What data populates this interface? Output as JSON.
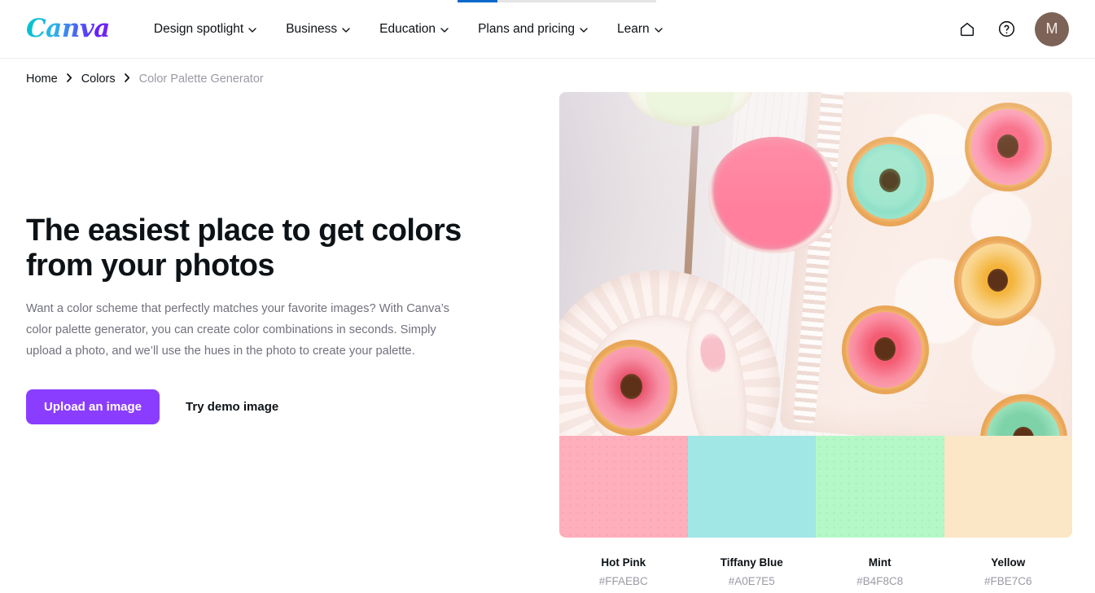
{
  "progress": {
    "percent": 20,
    "fill_color": "#0d69c9",
    "track_color": "#e4e4e6"
  },
  "header": {
    "logo_text": "Canva",
    "nav": [
      {
        "label": "Design spotlight",
        "icon": "chevron-down-icon"
      },
      {
        "label": "Business",
        "icon": "chevron-down-icon"
      },
      {
        "label": "Education",
        "icon": "chevron-down-icon"
      },
      {
        "label": "Plans and pricing",
        "icon": "chevron-down-icon"
      },
      {
        "label": "Learn",
        "icon": "chevron-down-icon"
      }
    ],
    "home_icon": "home-icon",
    "help_icon": "help-circle-icon",
    "avatar_initial": "M",
    "avatar_color": "#7d6357"
  },
  "breadcrumb": {
    "items": [
      {
        "label": "Home",
        "current": false
      },
      {
        "label": "Colors",
        "current": false
      },
      {
        "label": "Color Palette Generator",
        "current": true
      }
    ],
    "separator": "›"
  },
  "hero": {
    "title_line1": "The easiest place to get colors",
    "title_line2": "from your photos",
    "description": "Want a color scheme that perfectly matches your favorite images? With Canva’s color palette generator, you can create color combinations in seconds. Simply upload a photo, and we’ll use the hues in the photo to create your palette.",
    "primary_button": "Upload an image",
    "secondary_button": "Try demo image",
    "primary_button_color": "#8b3dff"
  },
  "preview": {
    "photo_alt": "Pastel glazed mini donuts on a ceramic tray with pink icing bowl",
    "palette": [
      {
        "name": "Hot Pink",
        "hex": "#FFAEBC"
      },
      {
        "name": "Tiffany Blue",
        "hex": "#A0E7E5"
      },
      {
        "name": "Mint",
        "hex": "#B4F8C8"
      },
      {
        "name": "Yellow",
        "hex": "#FBE7C6"
      }
    ]
  }
}
